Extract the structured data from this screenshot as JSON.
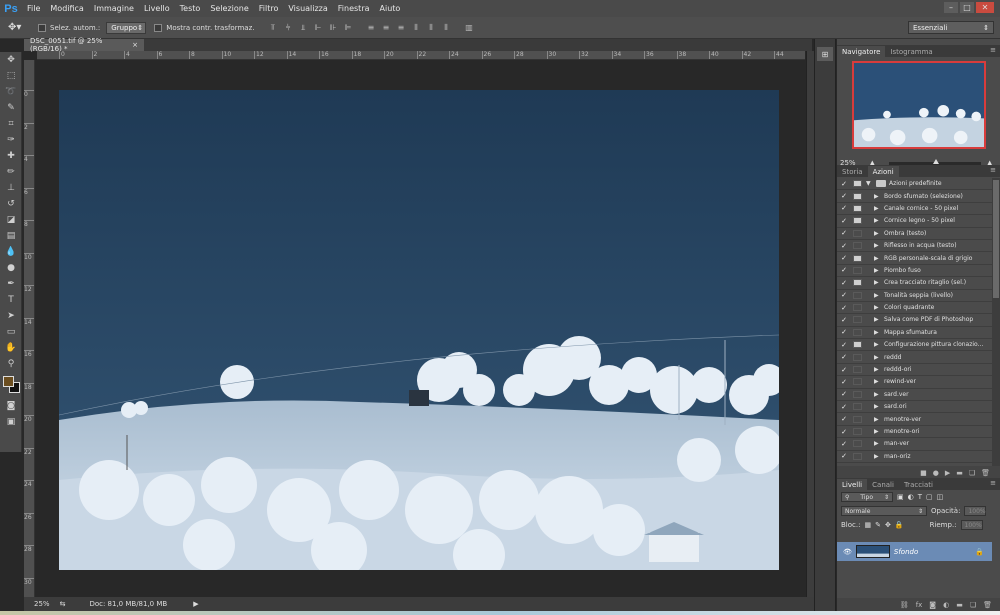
{
  "app": {
    "logo": "Ps"
  },
  "menu": [
    "File",
    "Modifica",
    "Immagine",
    "Livello",
    "Testo",
    "Selezione",
    "Filtro",
    "Visualizza",
    "Finestra",
    "Aiuto"
  ],
  "window_controls": {
    "minimize": "–",
    "restore": "□",
    "close": "✕"
  },
  "options": {
    "auto_select_label": "Selez. autom.:",
    "auto_select_value": "Gruppo",
    "show_transform_label": "Mostra contr. trasformaz.",
    "workspace": "Essenziali"
  },
  "document": {
    "tab_title": "DSC_0051.tif @ 25% (RGB/16) *",
    "tab_close": "×",
    "ruler_h": [
      "0",
      "2",
      "4",
      "6",
      "8",
      "10",
      "12",
      "14",
      "16",
      "18",
      "20",
      "22",
      "24",
      "26",
      "28",
      "30",
      "32",
      "34",
      "36",
      "38",
      "40",
      "42",
      "44",
      "46"
    ],
    "ruler_v": [
      "0",
      "2",
      "4",
      "6",
      "8",
      "10",
      "12",
      "14",
      "16",
      "18",
      "20",
      "22",
      "24",
      "26",
      "28",
      "30"
    ]
  },
  "status": {
    "zoom": "25%",
    "doc_info": "Doc: 81,0 MB/81,0 MB"
  },
  "navigator": {
    "tabs": [
      "Navigatore",
      "Istogramma"
    ],
    "zoom": "25%"
  },
  "actions_panel": {
    "tabs": [
      "Storia",
      "Azioni"
    ],
    "set_name": "Azioni predefinite",
    "items": [
      {
        "label": "Bordo sfumato (selezione)",
        "dialog": true
      },
      {
        "label": "Canale cornice - 50 pixel",
        "dialog": true
      },
      {
        "label": "Cornice legno - 50 pixel",
        "dialog": true
      },
      {
        "label": "Ombra (testo)",
        "dialog": false
      },
      {
        "label": "Riflesso in acqua (testo)",
        "dialog": false
      },
      {
        "label": "RGB personale-scala di grigio",
        "dialog": true
      },
      {
        "label": "Piombo fuso",
        "dialog": false
      },
      {
        "label": "Crea tracciato ritaglio (sel.)",
        "dialog": true
      },
      {
        "label": "Tonalità seppia (livello)",
        "dialog": false
      },
      {
        "label": "Colori quadrante",
        "dialog": false
      },
      {
        "label": "Salva come PDF di Photoshop",
        "dialog": false
      },
      {
        "label": "Mappa sfumatura",
        "dialog": false
      },
      {
        "label": "Configurazione pittura clonazio...",
        "dialog": true
      },
      {
        "label": "reddd",
        "dialog": false
      },
      {
        "label": "reddd-ori",
        "dialog": false
      },
      {
        "label": "rewind-ver",
        "dialog": false
      },
      {
        "label": "sard.ver",
        "dialog": false
      },
      {
        "label": "sard.ori",
        "dialog": false
      },
      {
        "label": "menotre-ver",
        "dialog": false
      },
      {
        "label": "menotre-ori",
        "dialog": false
      },
      {
        "label": "man-ver",
        "dialog": false
      },
      {
        "label": "man-oriz",
        "dialog": false
      }
    ],
    "footer_icons": [
      "stop-icon",
      "record-icon",
      "play-icon",
      "folder-icon",
      "new-icon",
      "trash-icon"
    ]
  },
  "layers_panel": {
    "tabs": [
      "Livelli",
      "Canali",
      "Tracciati"
    ],
    "filter": "Tipo",
    "blend_mode": "Normale",
    "opacity_label": "Opacità:",
    "opacity_value": "100%",
    "lock_label": "Bloc.:",
    "fill_label": "Riemp.:",
    "fill_value": "100%",
    "layer_name": "Sfondo"
  }
}
